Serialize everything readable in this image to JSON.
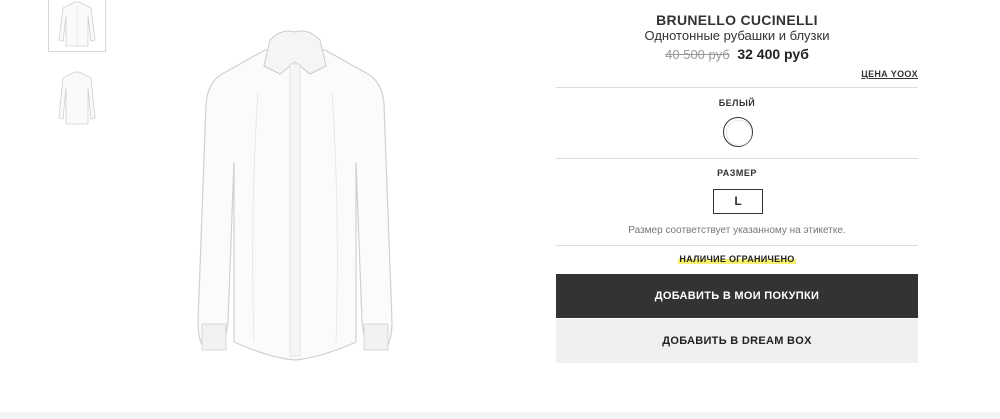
{
  "thumbnails": [
    {
      "name": "thumbnail-front",
      "selected": true
    },
    {
      "name": "thumbnail-back",
      "selected": false
    }
  ],
  "product": {
    "brand": "BRUNELLO CUCINELLI",
    "category": "Однотонные рубашки и блузки",
    "old_price": "40 500 руб",
    "new_price": "32 400 руб",
    "price_note": "ЦЕНА YOOX"
  },
  "color": {
    "label": "БЕЛЫЙ",
    "swatch_color": "#ffffff"
  },
  "size": {
    "label": "РАЗМЕР",
    "selected": "L",
    "note": "Размер соответствует указанному на этикетке."
  },
  "availability": "НАЛИЧИЕ ОГРАНИЧЕНО",
  "buttons": {
    "add_to_cart": "ДОБАВИТЬ В МОИ ПОКУПКИ",
    "add_to_dreambox": "ДОБАВИТЬ В DREAM BOX"
  },
  "colors": {
    "primary_button_bg": "#333333",
    "secondary_button_bg": "#efefef",
    "highlight": "#f7f06e"
  }
}
